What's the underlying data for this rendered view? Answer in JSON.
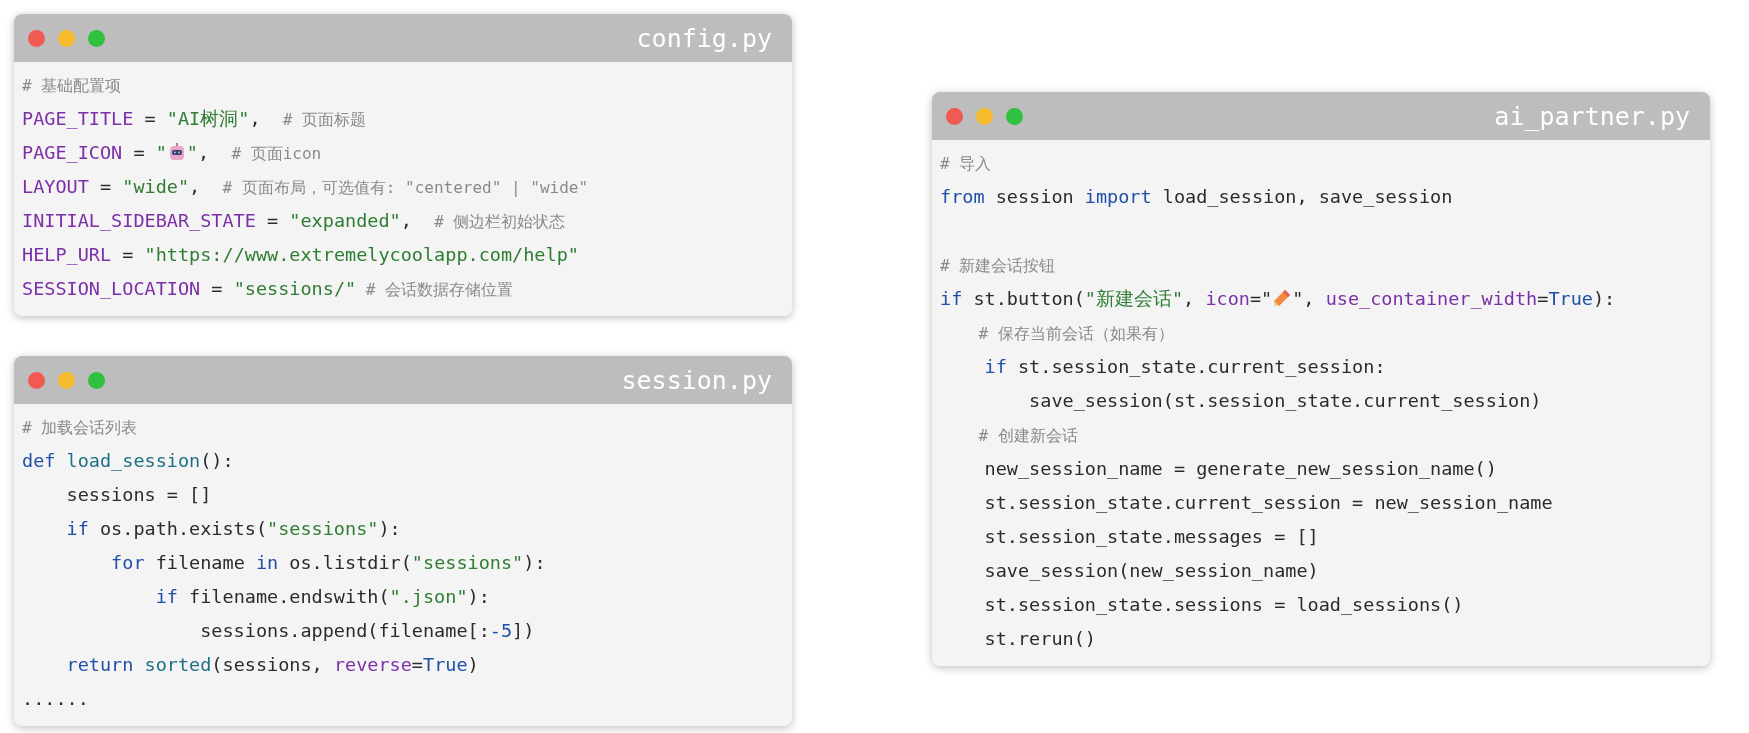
{
  "windows": [
    {
      "title": "config.py",
      "lines": [
        [
          {
            "kind": "comment",
            "text": "# 基础配置项"
          }
        ],
        [
          {
            "kind": "name",
            "text": "PAGE_TITLE"
          },
          {
            "kind": "plain",
            "text": " = "
          },
          {
            "kind": "string",
            "text": "\"AI树洞\""
          },
          {
            "kind": "plain",
            "text": ",  "
          },
          {
            "kind": "comment",
            "text": "# 页面标题"
          }
        ],
        [
          {
            "kind": "name",
            "text": "PAGE_ICON"
          },
          {
            "kind": "plain",
            "text": " = "
          },
          {
            "kind": "string",
            "text": "\""
          },
          {
            "kind": "robot"
          },
          {
            "kind": "string",
            "text": "\""
          },
          {
            "kind": "plain",
            "text": ",  "
          },
          {
            "kind": "comment",
            "text": "# 页面icon"
          }
        ],
        [
          {
            "kind": "name",
            "text": "LAYOUT"
          },
          {
            "kind": "plain",
            "text": " = "
          },
          {
            "kind": "string",
            "text": "\"wide\""
          },
          {
            "kind": "plain",
            "text": ",  "
          },
          {
            "kind": "comment",
            "text": "# 页面布局，可选值有: \"centered\" | \"wide\""
          }
        ],
        [
          {
            "kind": "name",
            "text": "INITIAL_SIDEBAR_STATE"
          },
          {
            "kind": "plain",
            "text": " = "
          },
          {
            "kind": "string",
            "text": "\"expanded\""
          },
          {
            "kind": "plain",
            "text": ",  "
          },
          {
            "kind": "comment",
            "text": "# 侧边栏初始状态"
          }
        ],
        [
          {
            "kind": "name",
            "text": "HELP_URL"
          },
          {
            "kind": "plain",
            "text": " = "
          },
          {
            "kind": "string",
            "text": "\"https://www.extremelycoolapp.com/help\""
          }
        ],
        [
          {
            "kind": "name",
            "text": "SESSION_LOCATION"
          },
          {
            "kind": "plain",
            "text": " = "
          },
          {
            "kind": "string",
            "text": "\"sessions/\""
          },
          {
            "kind": "comment",
            "text": " # 会话数据存储位置"
          }
        ]
      ]
    },
    {
      "title": "session.py",
      "lines": [
        [
          {
            "kind": "comment",
            "text": "# 加载会话列表"
          }
        ],
        [
          {
            "kind": "keyword",
            "text": "def"
          },
          {
            "kind": "function",
            "text": " load_session"
          },
          {
            "kind": "plain",
            "text": "():"
          }
        ],
        [
          {
            "kind": "plain",
            "text": "    sessions = []"
          }
        ],
        [
          {
            "kind": "keyword",
            "text": "    if"
          },
          {
            "kind": "plain",
            "text": " os.path.exists("
          },
          {
            "kind": "string",
            "text": "\"sessions\""
          },
          {
            "kind": "plain",
            "text": "):"
          }
        ],
        [
          {
            "kind": "keyword",
            "text": "        for"
          },
          {
            "kind": "plain",
            "text": " filename "
          },
          {
            "kind": "keyword",
            "text": "in"
          },
          {
            "kind": "plain",
            "text": " os.listdir("
          },
          {
            "kind": "string",
            "text": "\"sessions\""
          },
          {
            "kind": "plain",
            "text": "):"
          }
        ],
        [
          {
            "kind": "keyword",
            "text": "            if"
          },
          {
            "kind": "plain",
            "text": " filename.endswith("
          },
          {
            "kind": "string",
            "text": "\".json\""
          },
          {
            "kind": "plain",
            "text": "):"
          }
        ],
        [
          {
            "kind": "plain",
            "text": "                sessions.append(filename[:"
          },
          {
            "kind": "keyword",
            "text": "-5"
          },
          {
            "kind": "plain",
            "text": "])"
          }
        ],
        [
          {
            "kind": "keyword",
            "text": "    return"
          },
          {
            "kind": "function",
            "text": " sorted"
          },
          {
            "kind": "plain",
            "text": "(sessions, "
          },
          {
            "kind": "name",
            "text": "reverse"
          },
          {
            "kind": "plain",
            "text": "="
          },
          {
            "kind": "keyword",
            "text": "True"
          },
          {
            "kind": "plain",
            "text": ")"
          }
        ],
        [
          {
            "kind": "plain",
            "text": "......"
          }
        ]
      ]
    },
    {
      "title": "ai_partner.py",
      "lines": [
        [
          {
            "kind": "comment",
            "text": "# 导入"
          }
        ],
        [
          {
            "kind": "keyword",
            "text": "from"
          },
          {
            "kind": "plain",
            "text": " session "
          },
          {
            "kind": "keyword",
            "text": "import"
          },
          {
            "kind": "plain",
            "text": " load_session, save_session"
          }
        ],
        {
          "kind": "blank"
        },
        [
          {
            "kind": "comment",
            "text": "# 新建会话按钮"
          }
        ],
        [
          {
            "kind": "keyword",
            "text": "if"
          },
          {
            "kind": "plain",
            "text": " st.button("
          },
          {
            "kind": "string",
            "text": "\"新建会话\""
          },
          {
            "kind": "plain",
            "text": ", "
          },
          {
            "kind": "name",
            "text": "icon"
          },
          {
            "kind": "plain",
            "text": "=\""
          },
          {
            "kind": "pencil"
          },
          {
            "kind": "plain",
            "text": "\", "
          },
          {
            "kind": "name",
            "text": "use_container_width"
          },
          {
            "kind": "plain",
            "text": "="
          },
          {
            "kind": "keyword",
            "text": "True"
          },
          {
            "kind": "plain",
            "text": "):"
          }
        ],
        [
          {
            "kind": "comment",
            "text": "    # 保存当前会话（如果有）"
          }
        ],
        [
          {
            "kind": "keyword",
            "text": "    if"
          },
          {
            "kind": "plain",
            "text": " st.session_state.current_session:"
          }
        ],
        [
          {
            "kind": "plain",
            "text": "        save_session(st.session_state.current_session)"
          }
        ],
        [
          {
            "kind": "comment",
            "text": "    # 创建新会话"
          }
        ],
        [
          {
            "kind": "plain",
            "text": "    new_session_name = generate_new_session_name()"
          }
        ],
        [
          {
            "kind": "plain",
            "text": "    st.session_state.current_session = new_session_name"
          }
        ],
        [
          {
            "kind": "plain",
            "text": "    st.session_state.messages = []"
          }
        ],
        [
          {
            "kind": "plain",
            "text": "    save_session(new_session_name)"
          }
        ],
        [
          {
            "kind": "plain",
            "text": "    st.session_state.sessions = load_sessions()"
          }
        ],
        [
          {
            "kind": "plain",
            "text": "    st.rerun()"
          }
        ]
      ]
    }
  ]
}
